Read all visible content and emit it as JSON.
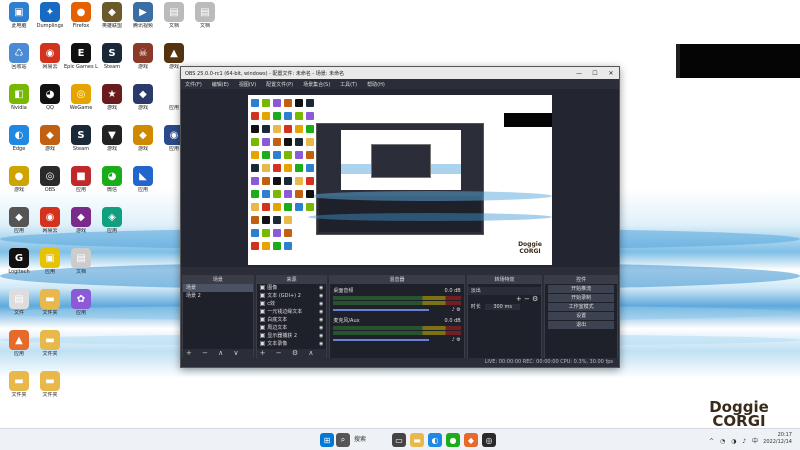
{
  "colors": {
    "obs_bg": "#2b2e38",
    "accent_blue": "#0078d4",
    "black_block": "#050505"
  },
  "desktop": {
    "icons": [
      {
        "label": "此电脑",
        "icon": "computer-icon",
        "color": "#2f7fd0",
        "glyph": "▣",
        "col": 0,
        "row": 0
      },
      {
        "label": "Dumplings",
        "icon": "app-icon",
        "color": "#1769c2",
        "glyph": "✦",
        "col": 1,
        "row": 0
      },
      {
        "label": "Firefox",
        "icon": "firefox-icon",
        "color": "#e66000",
        "glyph": "●",
        "col": 2,
        "row": 0
      },
      {
        "label": "英雄联盟",
        "icon": "game-icon",
        "color": "#6b5a2a",
        "glyph": "◆",
        "col": 3,
        "row": 0
      },
      {
        "label": "腾讯视频",
        "icon": "video-icon",
        "color": "#3a6ea5",
        "glyph": "▶",
        "col": 4,
        "row": 0
      },
      {
        "label": "文档",
        "icon": "file-icon",
        "color": "#bbbbbb",
        "glyph": "▤",
        "col": 5,
        "row": 0
      },
      {
        "label": "文档",
        "icon": "file-icon",
        "color": "#bbbbbb",
        "glyph": "▤",
        "col": 6,
        "row": 0
      },
      {
        "label": "回收站",
        "icon": "recycle-bin-icon",
        "color": "#4b8bd6",
        "glyph": "♺",
        "col": 0,
        "row": 1
      },
      {
        "label": "网易云",
        "icon": "music-icon",
        "color": "#d3321e",
        "glyph": "◉",
        "col": 1,
        "row": 1
      },
      {
        "label": "Epic Games Launcher",
        "icon": "epic-icon",
        "color": "#111111",
        "glyph": "E",
        "col": 2,
        "row": 1
      },
      {
        "label": "Steam",
        "icon": "steam-icon",
        "color": "#1b2838",
        "glyph": "S",
        "col": 3,
        "row": 1
      },
      {
        "label": "游戏",
        "icon": "game-icon",
        "color": "#8b3a2a",
        "glyph": "☠",
        "col": 4,
        "row": 1
      },
      {
        "label": "游戏",
        "icon": "game-icon",
        "color": "#553311",
        "glyph": "▲",
        "col": 5,
        "row": 1
      },
      {
        "label": "Nvidia",
        "icon": "nvidia-icon",
        "color": "#76b900",
        "glyph": "◧",
        "col": 0,
        "row": 2
      },
      {
        "label": "QQ",
        "icon": "qq-icon",
        "color": "#111111",
        "glyph": "◕",
        "col": 1,
        "row": 2
      },
      {
        "label": "WeGame",
        "icon": "wegame-icon",
        "color": "#e6a400",
        "glyph": "◎",
        "col": 2,
        "row": 2
      },
      {
        "label": "游戏",
        "icon": "game-icon",
        "color": "#6a1b1b",
        "glyph": "★",
        "col": 3,
        "row": 2
      },
      {
        "label": "游戏",
        "icon": "game-icon",
        "color": "#2a3a6a",
        "glyph": "◆",
        "col": 4,
        "row": 2
      },
      {
        "label": "应用",
        "icon": "app-icon",
        "color": "#ffffff",
        "glyph": "❁",
        "col": 5,
        "row": 2
      },
      {
        "label": "Edge",
        "icon": "edge-icon",
        "color": "#1e88e5",
        "glyph": "◐",
        "col": 0,
        "row": 3
      },
      {
        "label": "游戏",
        "icon": "game-icon",
        "color": "#c06010",
        "glyph": "◆",
        "col": 1,
        "row": 3
      },
      {
        "label": "Steam",
        "icon": "steam-icon",
        "color": "#1b2838",
        "glyph": "S",
        "col": 2,
        "row": 3
      },
      {
        "label": "游戏",
        "icon": "game-icon",
        "color": "#222222",
        "glyph": "▼",
        "col": 3,
        "row": 3
      },
      {
        "label": "游戏",
        "icon": "game-icon",
        "color": "#d08a00",
        "glyph": "◆",
        "col": 4,
        "row": 3
      },
      {
        "label": "应用",
        "icon": "app-icon",
        "color": "#2a4a8a",
        "glyph": "◉",
        "col": 5,
        "row": 3
      },
      {
        "label": "游戏",
        "icon": "game-icon",
        "color": "#cfa300",
        "glyph": "●",
        "col": 0,
        "row": 4
      },
      {
        "label": "OBS",
        "icon": "obs-icon",
        "color": "#2a2a2a",
        "glyph": "◎",
        "col": 1,
        "row": 4
      },
      {
        "label": "应用",
        "icon": "app-icon",
        "color": "#c0282a",
        "glyph": "■",
        "col": 2,
        "row": 4
      },
      {
        "label": "微信",
        "icon": "wechat-icon",
        "color": "#1aad19",
        "glyph": "◕",
        "col": 3,
        "row": 4
      },
      {
        "label": "应用",
        "icon": "app-icon",
        "color": "#2266cc",
        "glyph": "◣",
        "col": 4,
        "row": 4
      },
      {
        "label": "应用",
        "icon": "app-icon",
        "color": "#555555",
        "glyph": "◆",
        "col": 0,
        "row": 5
      },
      {
        "label": "网易云",
        "icon": "music-icon",
        "color": "#d3321e",
        "glyph": "◉",
        "col": 1,
        "row": 5
      },
      {
        "label": "游戏",
        "icon": "game-icon",
        "color": "#7a2a8a",
        "glyph": "◆",
        "col": 2,
        "row": 5
      },
      {
        "label": "应用",
        "icon": "app-icon",
        "color": "#10a080",
        "glyph": "◈",
        "col": 3,
        "row": 5
      },
      {
        "label": "Logitech",
        "icon": "logitech-icon",
        "color": "#111111",
        "glyph": "G",
        "col": 0,
        "row": 6
      },
      {
        "label": "应用",
        "icon": "app-icon",
        "color": "#e6c200",
        "glyph": "▣",
        "col": 1,
        "row": 6
      },
      {
        "label": "文档",
        "icon": "file-icon",
        "color": "#cccccc",
        "glyph": "▤",
        "col": 2,
        "row": 6
      },
      {
        "label": "文件",
        "icon": "file-icon",
        "color": "#dddddd",
        "glyph": "▤",
        "col": 0,
        "row": 7
      },
      {
        "label": "文件夹",
        "icon": "folder-icon",
        "color": "#e8b84a",
        "glyph": "▬",
        "col": 1,
        "row": 7
      },
      {
        "label": "应用",
        "icon": "app-icon",
        "color": "#8a5ad8",
        "glyph": "✿",
        "col": 2,
        "row": 7
      },
      {
        "label": "应用",
        "icon": "app-icon",
        "color": "#e66a2a",
        "glyph": "▲",
        "col": 0,
        "row": 8
      },
      {
        "label": "文件夹",
        "icon": "folder-icon",
        "color": "#e8b84a",
        "glyph": "▬",
        "col": 1,
        "row": 8
      },
      {
        "label": "文件夹",
        "icon": "folder-icon",
        "color": "#e8b84a",
        "glyph": "▬",
        "col": 0,
        "row": 9
      },
      {
        "label": "文件夹",
        "icon": "folder-icon",
        "color": "#e8b84a",
        "glyph": "▬",
        "col": 1,
        "row": 9
      }
    ],
    "brand": "Doggie CORGI"
  },
  "obs": {
    "title": "OBS 25.0.0-rc1 (64-bit, windows) - 配置文件: 未命名 - 场景: 未命名",
    "menu": [
      "文件(F)",
      "编辑(E)",
      "视图(V)",
      "配置文件(P)",
      "场景集合(S)",
      "工具(T)",
      "帮助(H)"
    ],
    "window_controls": [
      "—",
      "☐",
      "✕"
    ],
    "canvas_brand": "Doggie CORGI",
    "docks": {
      "scenes": {
        "title": "场景",
        "items": [
          "场景",
          "场景 2"
        ],
        "selected": 0
      },
      "sources": {
        "title": "来源",
        "items": [
          "图像",
          "文本 (GDI+) 2",
          "c效",
          "一元钱边缘文本",
          "白底文本",
          "周边文本",
          "显示器捕获 2",
          "文本录像"
        ]
      },
      "mixer": {
        "title": "混音器",
        "channels": [
          {
            "name": "桌面音频",
            "value": "0.0 dB"
          },
          {
            "name": "麦克风/Aux",
            "value": "0.0 dB"
          }
        ]
      },
      "transitions": {
        "title": "转场特效",
        "type": "淡出",
        "duration_label": "时长",
        "duration": "300 ms"
      },
      "controls": {
        "title": "控件",
        "buttons": [
          "开始推流",
          "开始录制",
          "工作室模式",
          "设置",
          "退出"
        ]
      }
    },
    "status": "LIVE: 00:00:00   REC: 00:00:00   CPU: 0.3%, 30.00 fps"
  },
  "taskbar": {
    "search_label": "搜索",
    "apps": [
      {
        "icon": "windows-start-icon",
        "color": "#0078d4",
        "glyph": "⊞"
      },
      {
        "icon": "search-icon",
        "color": "#555555",
        "glyph": "⌕"
      },
      {
        "icon": "task-view-icon",
        "color": "#444444",
        "glyph": "▭"
      },
      {
        "icon": "file-explorer-icon",
        "color": "#e8b84a",
        "glyph": "▬"
      },
      {
        "icon": "edge-icon",
        "color": "#1e88e5",
        "glyph": "◐"
      },
      {
        "icon": "app-icon",
        "color": "#1aad19",
        "glyph": "●"
      },
      {
        "icon": "app-icon",
        "color": "#e66a2a",
        "glyph": "◆"
      },
      {
        "icon": "obs-icon",
        "color": "#2a2a2a",
        "glyph": "◎"
      }
    ],
    "tray_icons": "^ ◔ ◑ ♪ 中",
    "time": "20:17",
    "date": "2022/12/14"
  }
}
